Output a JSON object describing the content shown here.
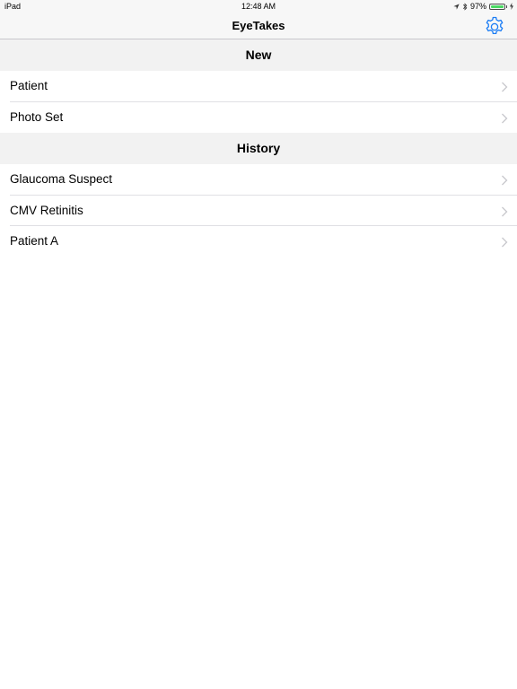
{
  "status_bar": {
    "device": "iPad",
    "time": "12:48 AM",
    "battery_percent": "97%",
    "battery_level": 0.97,
    "icons": [
      "location-arrow-icon",
      "bluetooth-icon",
      "battery-icon",
      "charging-bolt-icon"
    ]
  },
  "nav": {
    "title": "EyeTakes",
    "settings_icon": "gear-icon",
    "accent_color": "#1a7cf5"
  },
  "sections": {
    "new": {
      "header": "New",
      "items": [
        {
          "label": "Patient"
        },
        {
          "label": "Photo Set"
        }
      ]
    },
    "history": {
      "header": "History",
      "items": [
        {
          "label": "Glaucoma Suspect"
        },
        {
          "label": "CMV Retinitis"
        },
        {
          "label": "Patient A"
        }
      ]
    }
  }
}
